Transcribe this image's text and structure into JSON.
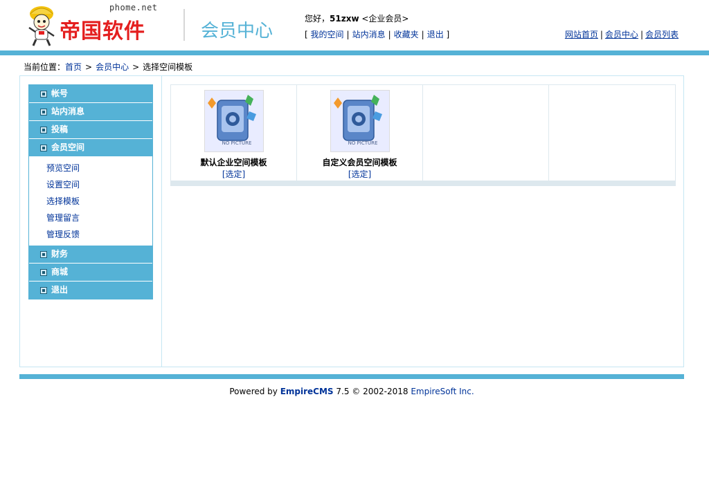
{
  "header": {
    "site_domain": "phome.net",
    "brand": "帝国软件",
    "member_center": "会员中心",
    "greeting_prefix": "您好，",
    "username": "51zxw",
    "user_group": "<企业会员>",
    "user_links": [
      "我的空间",
      "站内消息",
      "收藏夹",
      "退出"
    ],
    "nav": [
      "网站首页",
      "会员中心",
      "会员列表"
    ]
  },
  "breadcrumb": {
    "prefix": "当前位置：",
    "items": [
      "首页",
      "会员中心",
      "选择空间模板"
    ]
  },
  "menu": {
    "sections": [
      {
        "label": "帐号"
      },
      {
        "label": "站内消息"
      },
      {
        "label": "投稿"
      },
      {
        "label": "会员空间",
        "items": [
          "预览空间",
          "设置空间",
          "选择模板",
          "管理留言",
          "管理反馈"
        ]
      },
      {
        "label": "财务"
      },
      {
        "label": "商城"
      },
      {
        "label": "退出"
      }
    ]
  },
  "templates": [
    {
      "name": "默认企业空间模板",
      "action": "[选定]",
      "thumb_text": "NO PICTURE"
    },
    {
      "name": "自定义会员空间模板",
      "action": "[选定]",
      "thumb_text": "NO PICTURE"
    }
  ],
  "footer": {
    "powered": "Powered by ",
    "product": "EmpireCMS",
    "version": " 7.5  © 2002-2018 ",
    "company": "EmpireSoft Inc."
  },
  "colors": {
    "accent": "#55b2d6",
    "brand_red": "#e41f1f",
    "link": "#003399",
    "border": "#c5e6f3"
  }
}
